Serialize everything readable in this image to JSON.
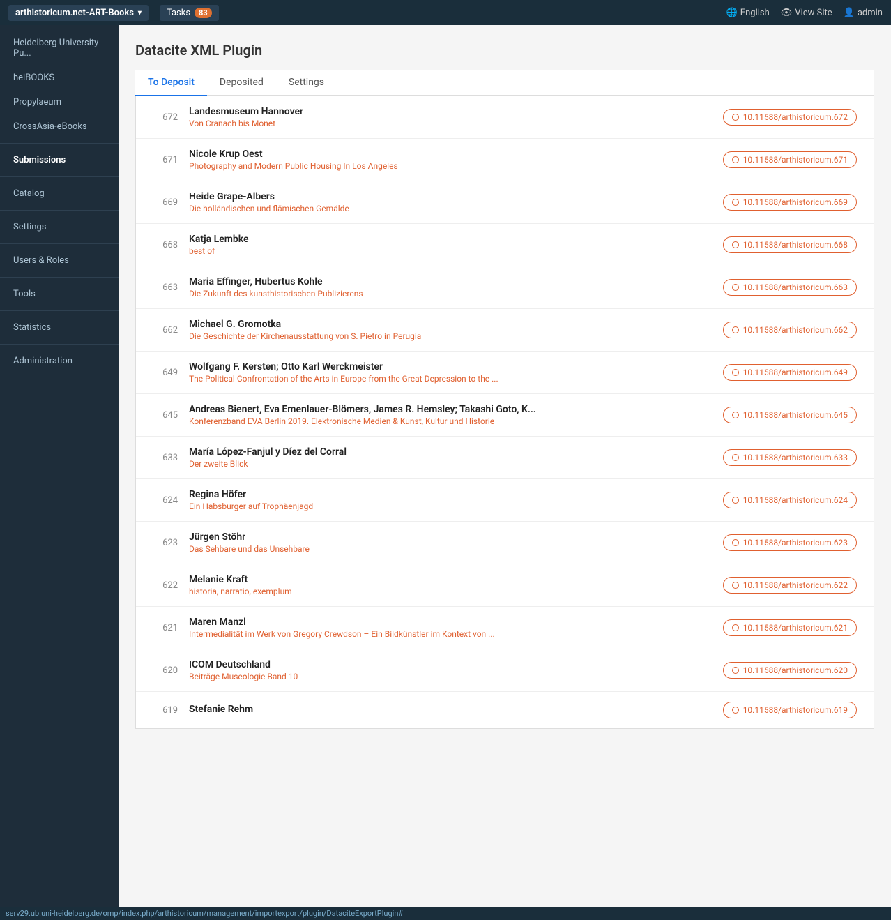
{
  "topnav": {
    "brand": "arthistoricum.net-ART-Books",
    "tasks_label": "Tasks",
    "tasks_count": "83",
    "english_label": "English",
    "viewsite_label": "View Site",
    "admin_label": "admin"
  },
  "sidebar": {
    "items": [
      {
        "id": "heidelberg",
        "label": "Heidelberg University Pu...",
        "active": false,
        "type": "link"
      },
      {
        "id": "heibooks",
        "label": "heiBOOKS",
        "active": false,
        "type": "link"
      },
      {
        "id": "propylaeum",
        "label": "Propylaeum",
        "active": false,
        "type": "link"
      },
      {
        "id": "crossasia",
        "label": "CrossAsia-eBooks",
        "active": false,
        "type": "link"
      },
      {
        "id": "submissions",
        "label": "Submissions",
        "active": true,
        "type": "section"
      },
      {
        "id": "catalog",
        "label": "Catalog",
        "active": false,
        "type": "link"
      },
      {
        "id": "settings",
        "label": "Settings",
        "active": false,
        "type": "link"
      },
      {
        "id": "users-roles",
        "label": "Users & Roles",
        "active": false,
        "type": "link"
      },
      {
        "id": "tools",
        "label": "Tools",
        "active": false,
        "type": "link"
      },
      {
        "id": "statistics",
        "label": "Statistics",
        "active": false,
        "type": "link"
      },
      {
        "id": "administration",
        "label": "Administration",
        "active": false,
        "type": "link"
      }
    ]
  },
  "main": {
    "title": "Datacite XML Plugin",
    "tabs": [
      {
        "id": "to-deposit",
        "label": "To Deposit",
        "active": true
      },
      {
        "id": "deposited",
        "label": "Deposited",
        "active": false
      },
      {
        "id": "settings",
        "label": "Settings",
        "active": false
      }
    ],
    "submissions": [
      {
        "id": "672",
        "title": "Landesmuseum Hannover",
        "subtitle": "Von Cranach bis Monet",
        "doi": "10.11588/arthistoricum.672"
      },
      {
        "id": "671",
        "title": "Nicole Krup Oest",
        "subtitle": "Photography and Modern Public Housing In Los Angeles",
        "doi": "10.11588/arthistoricum.671"
      },
      {
        "id": "669",
        "title": "Heide Grape-Albers",
        "subtitle": "Die holländischen und flämischen Gemälde",
        "doi": "10.11588/arthistoricum.669"
      },
      {
        "id": "668",
        "title": "Katja Lembke",
        "subtitle": "best of",
        "doi": "10.11588/arthistoricum.668"
      },
      {
        "id": "663",
        "title": "Maria Effinger, Hubertus Kohle",
        "subtitle": "Die Zukunft des kunsthistorischen Publizierens",
        "doi": "10.11588/arthistoricum.663"
      },
      {
        "id": "662",
        "title": "Michael G. Gromotka",
        "subtitle": "Die Geschichte der Kirchenausstattung von S. Pietro in Perugia",
        "doi": "10.11588/arthistoricum.662"
      },
      {
        "id": "649",
        "title": "Wolfgang F. Kersten; Otto Karl Werckmeister",
        "subtitle": "The Political Confrontation of the Arts in Europe from the Great Depression to the ...",
        "doi": "10.11588/arthistoricum.649"
      },
      {
        "id": "645",
        "title": "Andreas Bienert, Eva Emenlauer-Blömers, James R. Hemsley; Takashi Goto, K...",
        "subtitle": "Konferenzband EVA Berlin 2019. Elektronische Medien & Kunst, Kultur und Historie",
        "doi": "10.11588/arthistoricum.645"
      },
      {
        "id": "633",
        "title": "María López-Fanjul y Díez del Corral",
        "subtitle": "Der zweite Blick",
        "doi": "10.11588/arthistoricum.633"
      },
      {
        "id": "624",
        "title": "Regina Höfer",
        "subtitle": "Ein Habsburger auf Trophäenjagd",
        "doi": "10.11588/arthistoricum.624"
      },
      {
        "id": "623",
        "title": "Jürgen Stöhr",
        "subtitle": "Das Sehbare und das Unsehbare",
        "doi": "10.11588/arthistoricum.623"
      },
      {
        "id": "622",
        "title": "Melanie Kraft",
        "subtitle": "historia, narratio, exemplum",
        "doi": "10.11588/arthistoricum.622"
      },
      {
        "id": "621",
        "title": "Maren Manzl",
        "subtitle": "Intermedialität im Werk von Gregory Crewdson – Ein Bildkünstler im Kontext von ...",
        "doi": "10.11588/arthistoricum.621"
      },
      {
        "id": "620",
        "title": "ICOM Deutschland",
        "subtitle": "Beiträge Museologie Band 10",
        "doi": "10.11588/arthistoricum.620"
      },
      {
        "id": "619",
        "title": "Stefanie Rehm",
        "subtitle": "",
        "doi": "10.11588/arthistoricum.619"
      }
    ]
  },
  "statusbar": {
    "url": "serv29.ub.uni-heidelberg.de/omp/index.php/arthistoricum/management/importexport/plugin/DataciteExportPlugin#"
  }
}
